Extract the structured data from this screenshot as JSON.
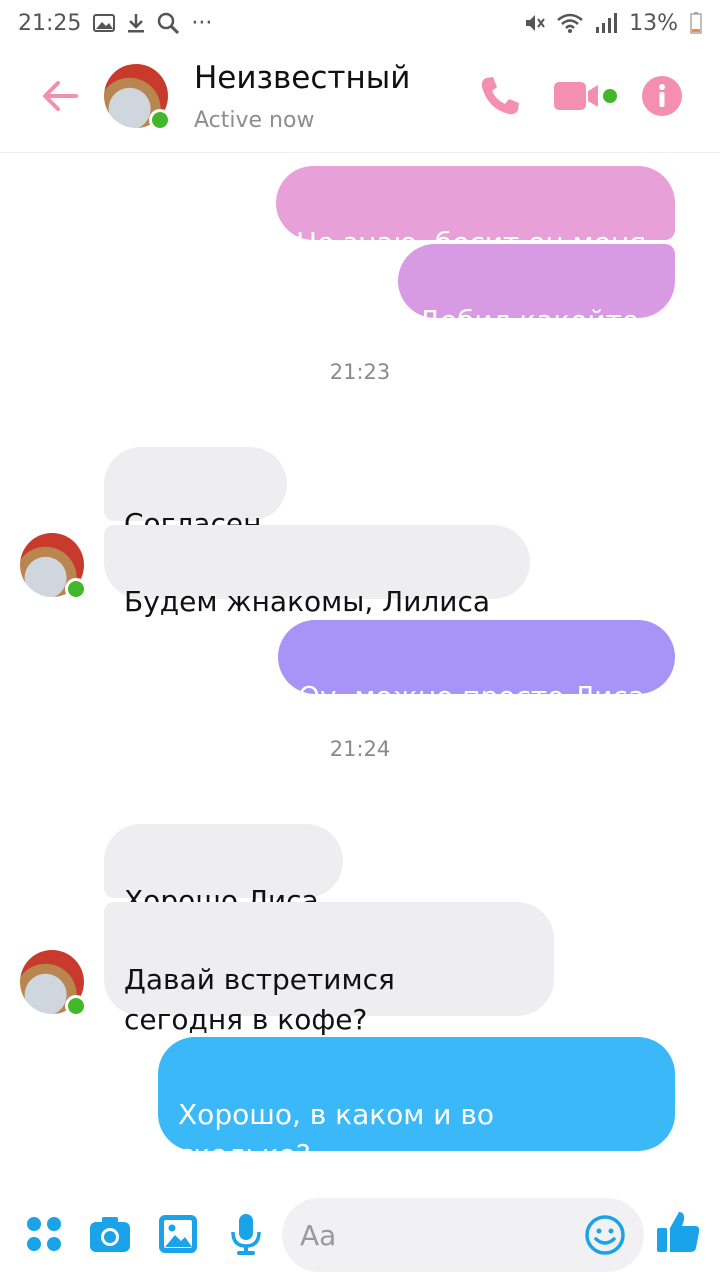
{
  "status_bar": {
    "time": "21:25",
    "more": "···",
    "battery": "13%"
  },
  "header": {
    "name": "Неизвестный",
    "status": "Active now"
  },
  "messages": [
    {
      "text": "Не знаю, бесит он меня"
    },
    {
      "text": "Дебил какойто"
    },
    {
      "time": "21:23"
    },
    {
      "text": "Согласен"
    },
    {
      "text": "Будем жнакомы, Лилиса"
    },
    {
      "text": "Оу, можно просто Лиса"
    },
    {
      "time": "21:24"
    },
    {
      "text": "Хорошо,Лиса"
    },
    {
      "text": "Давай встретимся\nсегодня в кофе?"
    },
    {
      "text": "Хорошо, в каком и во\nсколько?"
    }
  ],
  "composer": {
    "placeholder": "Aa"
  },
  "colors": {
    "accent": "#f48fb1",
    "bubble_pink": "#e8a0d8",
    "bubble_purple": "#a694f7",
    "bubble_blue": "#3ab8f8",
    "incoming_bubble": "#eeedf0",
    "online": "#42b72a"
  },
  "icons": [
    "back-arrow-icon",
    "phone-icon",
    "video-camera-icon",
    "info-icon",
    "apps-icon",
    "camera-icon",
    "image-icon",
    "microphone-icon",
    "emoji-icon",
    "thumbs-up-icon"
  ]
}
